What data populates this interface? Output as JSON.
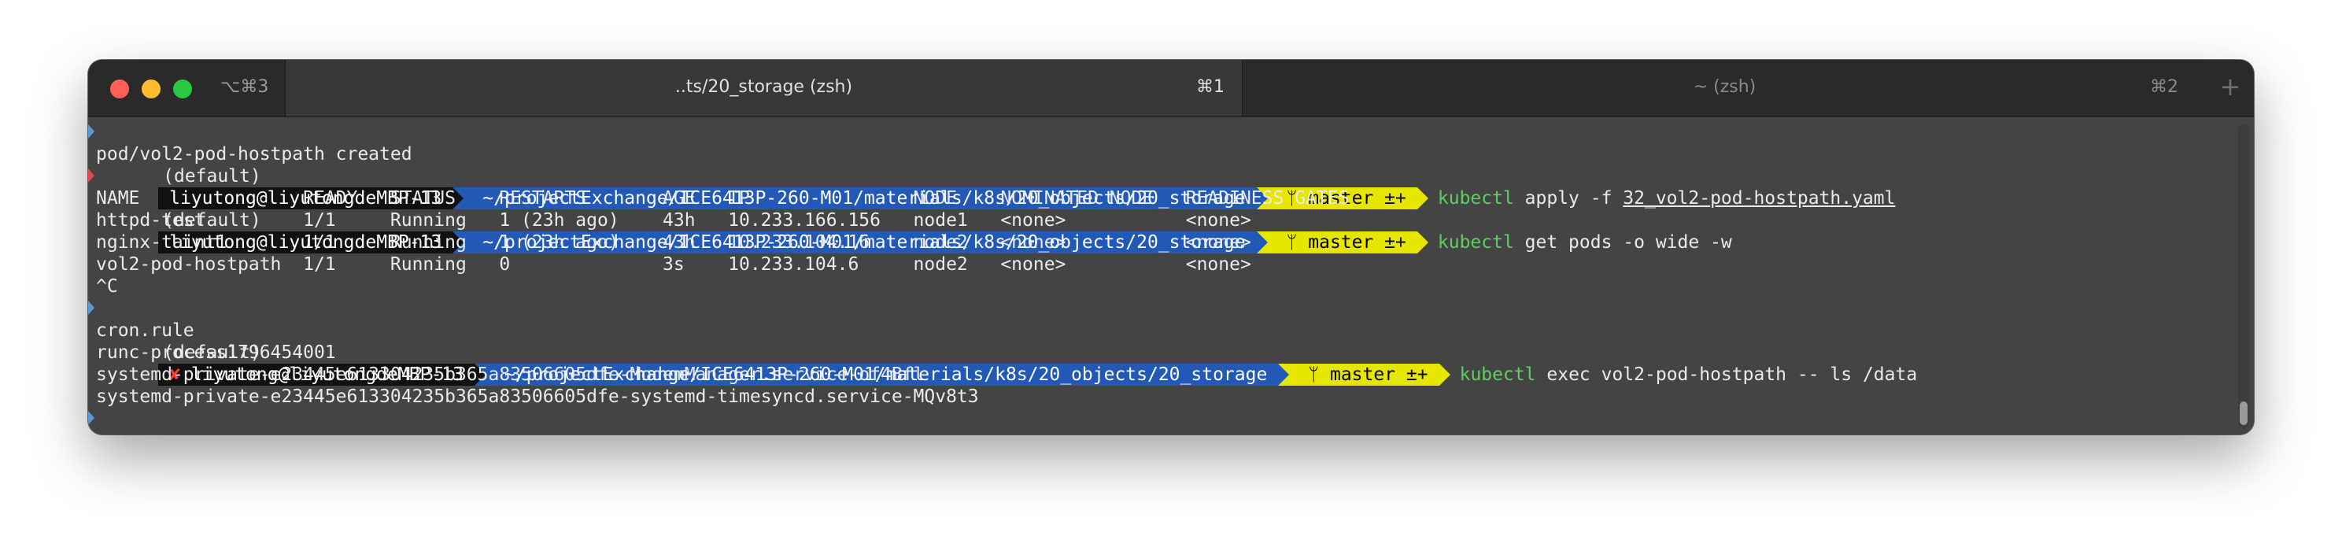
{
  "window": {
    "shortcut": "⌥⌘3",
    "tabs": [
      {
        "title": "..ts/20_storage (zsh)",
        "shortcut": "⌘1"
      },
      {
        "title": "~ (zsh)",
        "shortcut": "⌘2"
      }
    ],
    "new_tab": "+"
  },
  "prompt": {
    "env": "(default)",
    "user": "liyutong@liyutongdeMBP-13",
    "path": "~/projectExchange/ICE6413P-260-M01/materials/k8s/20_objects/20_storage",
    "git": "master ±+",
    "git_icon": "branch-icon",
    "error_mark": "✘"
  },
  "commands": [
    {
      "cmd": "kubectl",
      "args": " apply -f ",
      "file": "32_vol2-pod-hostpath.yaml"
    },
    {
      "cmd": "kubectl",
      "args": " get pods -o wide -w"
    },
    {
      "cmd": "kubectl",
      "args": " exec vol2-pod-hostpath -- ls /data"
    }
  ],
  "outputs": {
    "apply": "pod/vol2-pod-hostpath created",
    "table": [
      "NAME               READY   STATUS    RESTARTS       AGE   IP               NODE    NOMINATED NODE   READINESS GATES",
      "httpd-test         1/1     Running   1 (23h ago)    43h   10.233.166.156   node1   <none>           <none>",
      "nginx-taint1       1/1     Running   1 (23h ago)    43h   10.233.104.16    node2   <none>           <none>",
      "vol2-pod-hostpath  1/1     Running   0              3s    10.233.104.6     node2   <none>           <none>"
    ],
    "interrupt": "^C",
    "ls": [
      "cron.rule",
      "runc-process1796454001",
      "systemd-private-e23445e613304235b365a83506605dfe-ModemManager.service-of4Bfl",
      "systemd-private-e23445e613304235b365a83506605dfe-systemd-timesyncd.service-MQv8t3"
    ]
  }
}
